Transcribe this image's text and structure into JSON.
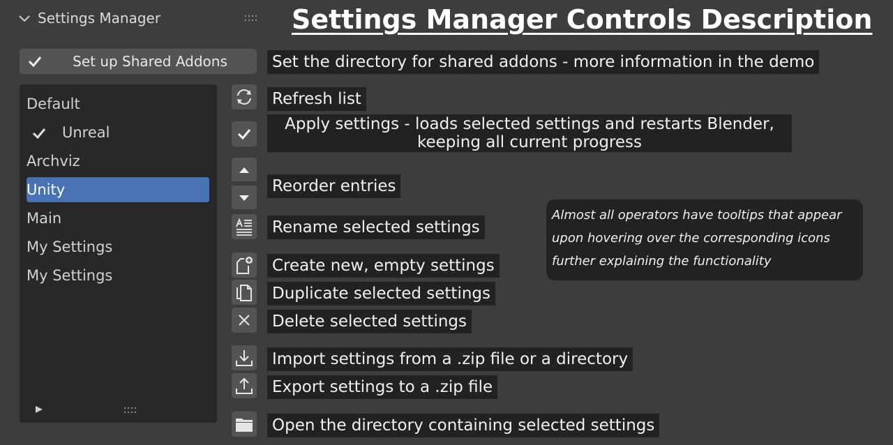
{
  "panel": {
    "title": "Settings Manager"
  },
  "main_title": "Settings Manager Controls Description",
  "setup_button": {
    "label": "Set up Shared Addons"
  },
  "list": {
    "items": [
      {
        "label": "Default",
        "checked": false,
        "selected": false
      },
      {
        "label": "Unreal",
        "checked": true,
        "selected": false
      },
      {
        "label": "Archviz",
        "checked": false,
        "selected": false
      },
      {
        "label": "Unity",
        "checked": false,
        "selected": true
      },
      {
        "label": "Main",
        "checked": false,
        "selected": false
      },
      {
        "label": "My Settings",
        "checked": false,
        "selected": false
      },
      {
        "label": "My Settings",
        "checked": false,
        "selected": false
      }
    ]
  },
  "descriptions": {
    "setup": "Set the directory for shared addons - more information in the demo",
    "refresh": "Refresh list",
    "apply_line1": "Apply settings - loads selected settings and restarts Blender,",
    "apply_line2": "keeping all current progress",
    "reorder": "Reorder entries",
    "rename": "Rename selected settings",
    "create": "Create new, empty settings",
    "duplicate": "Duplicate selected settings",
    "delete": "Delete selected settings",
    "import": "Import settings from a .zip file or a directory",
    "export": "Export settings to a .zip file",
    "open_dir": "Open the directory containing selected settings"
  },
  "note": {
    "line1": "Almost all operators have tooltips that appear",
    "line2": "upon hovering over the corresponding icons",
    "line3": "further explaining the functionality"
  },
  "icons": {
    "refresh": "refresh-icon",
    "apply": "checkmark-icon",
    "up": "triangle-up-icon",
    "down": "triangle-down-icon",
    "rename": "rename-icon",
    "create": "new-file-icon",
    "duplicate": "duplicate-icon",
    "delete": "close-icon",
    "import": "import-icon",
    "export": "export-icon",
    "folder": "folder-icon"
  },
  "colors": {
    "background": "#3d3d3d",
    "list_background": "#282828",
    "button": "#545454",
    "selected": "#4772b3",
    "label_background": "#222222"
  }
}
